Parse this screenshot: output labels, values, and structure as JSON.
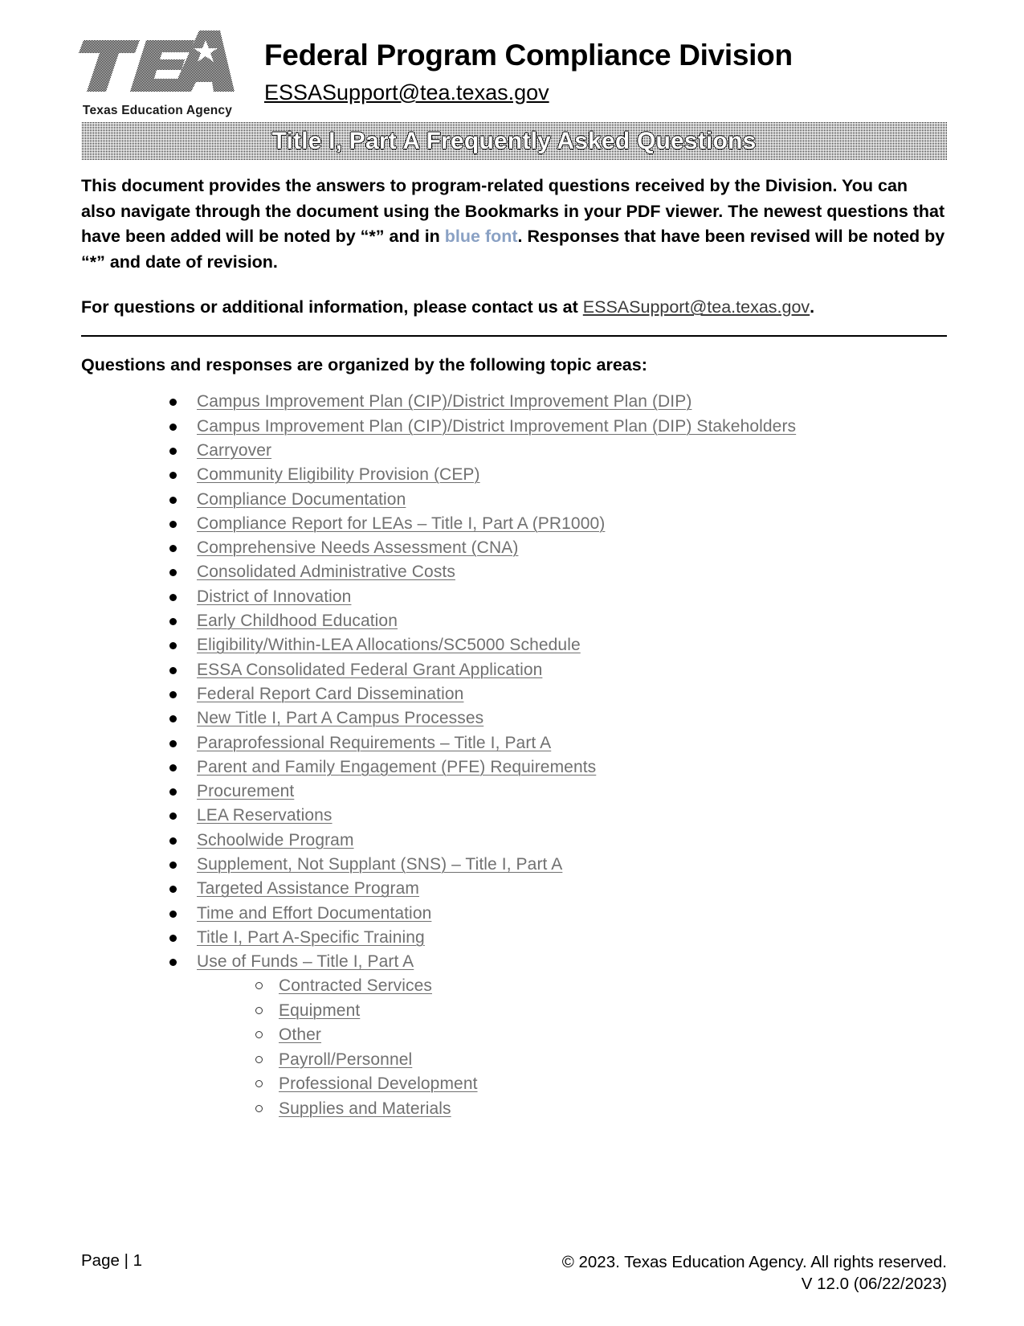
{
  "header": {
    "logo_text": "TEA",
    "logo_caption": "Texas Education Agency",
    "division_title": "Federal Program Compliance Division",
    "division_email": "ESSASupport@tea.texas.gov"
  },
  "banner": {
    "title": "Title I, Part A Frequently Asked Questions"
  },
  "intro": {
    "part1": "This document provides the answers to program-related questions received by the Division.  You can also navigate through the document using the Bookmarks in your PDF viewer.  The newest questions that have been added will be noted by “*” and in ",
    "blue_text": "blue font",
    "part2": ".  Responses that have been revised will be noted by “*” and date of revision."
  },
  "contact": {
    "prefix": "For questions or additional information, please contact us at ",
    "email": "ESSASupport@tea.texas.gov",
    "suffix": "."
  },
  "topics_heading": "Questions and responses are organized by the following topic areas:",
  "topics": [
    {
      "label": "Campus Improvement Plan (CIP)/District Improvement Plan (DIP)"
    },
    {
      "label": "Campus Improvement Plan (CIP)/District Improvement Plan (DIP) Stakeholders"
    },
    {
      "label": "Carryover"
    },
    {
      "label": "Community Eligibility Provision (CEP)"
    },
    {
      "label": "Compliance Documentation"
    },
    {
      "label": "Compliance Report for LEAs – Title I, Part A (PR1000)"
    },
    {
      "label": "Comprehensive Needs Assessment (CNA)"
    },
    {
      "label": "Consolidated Administrative Costs"
    },
    {
      "label": "District of Innovation"
    },
    {
      "label": "Early Childhood Education"
    },
    {
      "label": "Eligibility/Within-LEA Allocations/SC5000 Schedule"
    },
    {
      "label": "ESSA Consolidated Federal Grant Application"
    },
    {
      "label": "Federal Report Card Dissemination"
    },
    {
      "label": "New Title I, Part A Campus Processes"
    },
    {
      "label": "Paraprofessional Requirements – Title I, Part A"
    },
    {
      "label": "Parent and Family Engagement (PFE) Requirements"
    },
    {
      "label": "Procurement"
    },
    {
      "label": "LEA Reservations"
    },
    {
      "label": "Schoolwide Program"
    },
    {
      "label": "Supplement, Not Supplant (SNS) – Title I, Part A"
    },
    {
      "label": "Targeted Assistance Program"
    },
    {
      "label": "Time and Effort Documentation"
    },
    {
      "label": "Title I, Part A-Specific Training"
    },
    {
      "label": "Use of Funds – Title I, Part A"
    }
  ],
  "subtopics": [
    {
      "label": "Contracted Services"
    },
    {
      "label": "Equipment"
    },
    {
      "label": "Other"
    },
    {
      "label": "Payroll/Personnel"
    },
    {
      "label": "Professional Development"
    },
    {
      "label": "Supplies and Materials"
    }
  ],
  "footer": {
    "page_label": "Page | 1",
    "copyright": "© 2023. Texas Education Agency. All rights reserved.",
    "version": "V 12.0 (06/22/2023)"
  },
  "colors": {
    "link": "#707070",
    "blue_font": "#8aa1c4",
    "banner_bg": "#111111",
    "text": "#000000"
  }
}
